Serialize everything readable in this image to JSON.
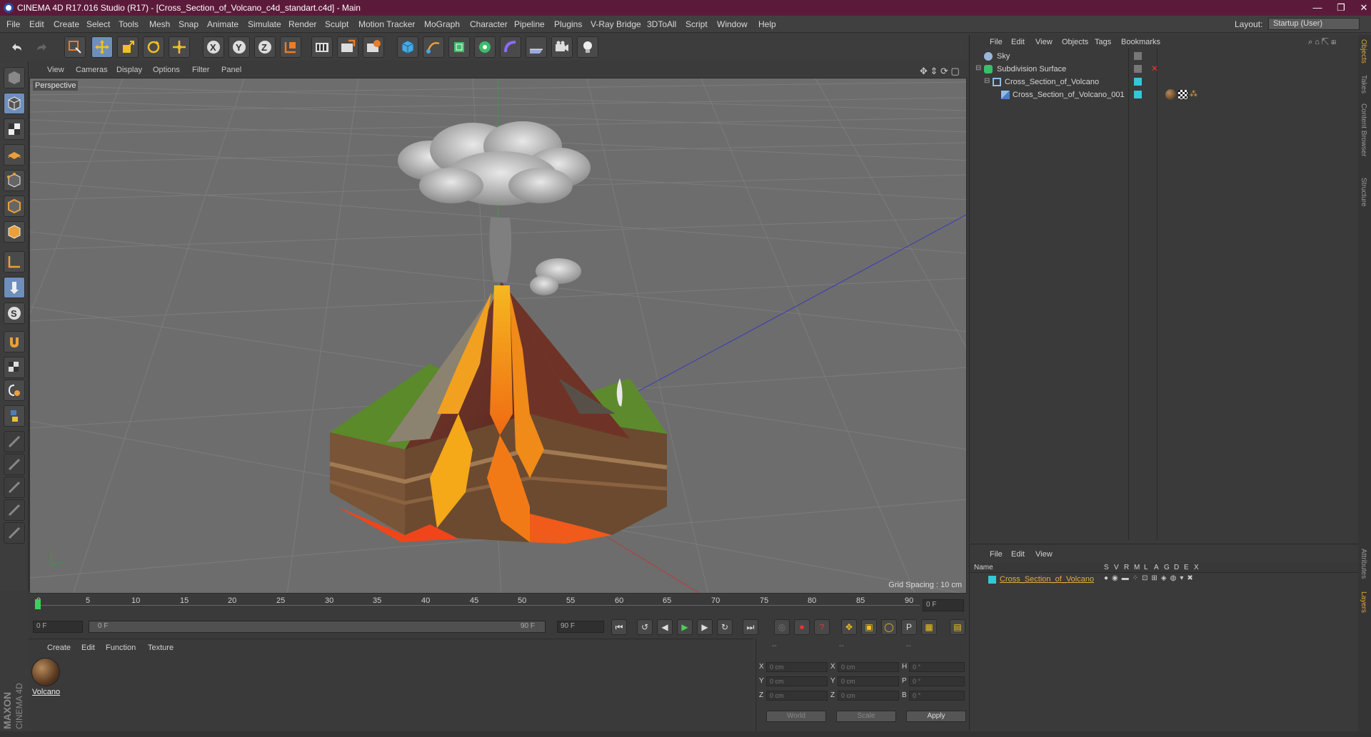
{
  "window": {
    "title": "CINEMA 4D R17.016 Studio (R17) - [Cross_Section_of_Volcano_c4d_standart.c4d] - Main",
    "minimize": "—",
    "maximize": "❐",
    "close": "✕"
  },
  "menu": [
    "File",
    "Edit",
    "Create",
    "Select",
    "Tools",
    "Mesh",
    "Snap",
    "Animate",
    "Simulate",
    "Render",
    "Sculpt",
    "Motion Tracker",
    "MoGraph",
    "Character",
    "Pipeline",
    "Plugins",
    "V-Ray Bridge",
    "3DToAll",
    "Script",
    "Window",
    "Help"
  ],
  "layout": {
    "label": "Layout:",
    "value": "Startup (User)"
  },
  "viewport": {
    "menu": [
      "View",
      "Cameras",
      "Display",
      "Options",
      "Filter",
      "Panel"
    ],
    "label": "Perspective",
    "grid_spacing": "Grid Spacing : 10 cm"
  },
  "timeline": {
    "ticks": [
      "0",
      "5",
      "10",
      "15",
      "20",
      "25",
      "30",
      "35",
      "40",
      "45",
      "50",
      "55",
      "60",
      "65",
      "70",
      "75",
      "80",
      "85",
      "90"
    ],
    "current_frame": "0 F",
    "start_field": "0 F",
    "range_start": "0 F",
    "range_end": "90 F",
    "end_field": "90 F"
  },
  "material_panel": {
    "menu": [
      "Create",
      "Edit",
      "Function",
      "Texture"
    ],
    "materials": [
      {
        "name": "Volcano"
      }
    ]
  },
  "coord_panel": {
    "header": [
      "--",
      "--",
      "--"
    ],
    "rows": [
      {
        "a": "X",
        "av": "0 cm",
        "b": "X",
        "bv": "0 cm",
        "c": "H",
        "cv": "0 °"
      },
      {
        "a": "Y",
        "av": "0 cm",
        "b": "Y",
        "bv": "0 cm",
        "c": "P",
        "cv": "0 °"
      },
      {
        "a": "Z",
        "av": "0 cm",
        "b": "Z",
        "bv": "0 cm",
        "c": "B",
        "cv": "0 °"
      }
    ],
    "mode": "World",
    "scale": "Scale",
    "apply": "Apply"
  },
  "object_manager": {
    "menu": [
      "File",
      "Edit",
      "View",
      "Objects",
      "Tags",
      "Bookmarks"
    ],
    "objects": [
      {
        "name": "Sky",
        "indent": 0
      },
      {
        "name": "Subdivision Surface",
        "indent": 0
      },
      {
        "name": "Cross_Section_of_Volcano",
        "indent": 1
      },
      {
        "name": "Cross_Section_of_Volcano_001",
        "indent": 2
      }
    ]
  },
  "layer_manager": {
    "menu": [
      "File",
      "Edit",
      "View"
    ],
    "columns": [
      "Name",
      "S",
      "V",
      "R",
      "M",
      "L",
      "A",
      "G",
      "D",
      "E",
      "X"
    ],
    "layers": [
      {
        "name": "Cross_Section_of_Volcano",
        "color": "#35c6d9"
      }
    ]
  },
  "side_tabs": [
    "Objects",
    "Takes",
    "Content Browser",
    "Structure",
    "Attributes",
    "Layers"
  ],
  "brand": {
    "maxon": "MAXON",
    "cinema": "CINEMA 4D"
  },
  "colors": {
    "accent": "#6e8fbb",
    "title_bar": "#5c1a3a",
    "layer_name": "#e0b040"
  }
}
